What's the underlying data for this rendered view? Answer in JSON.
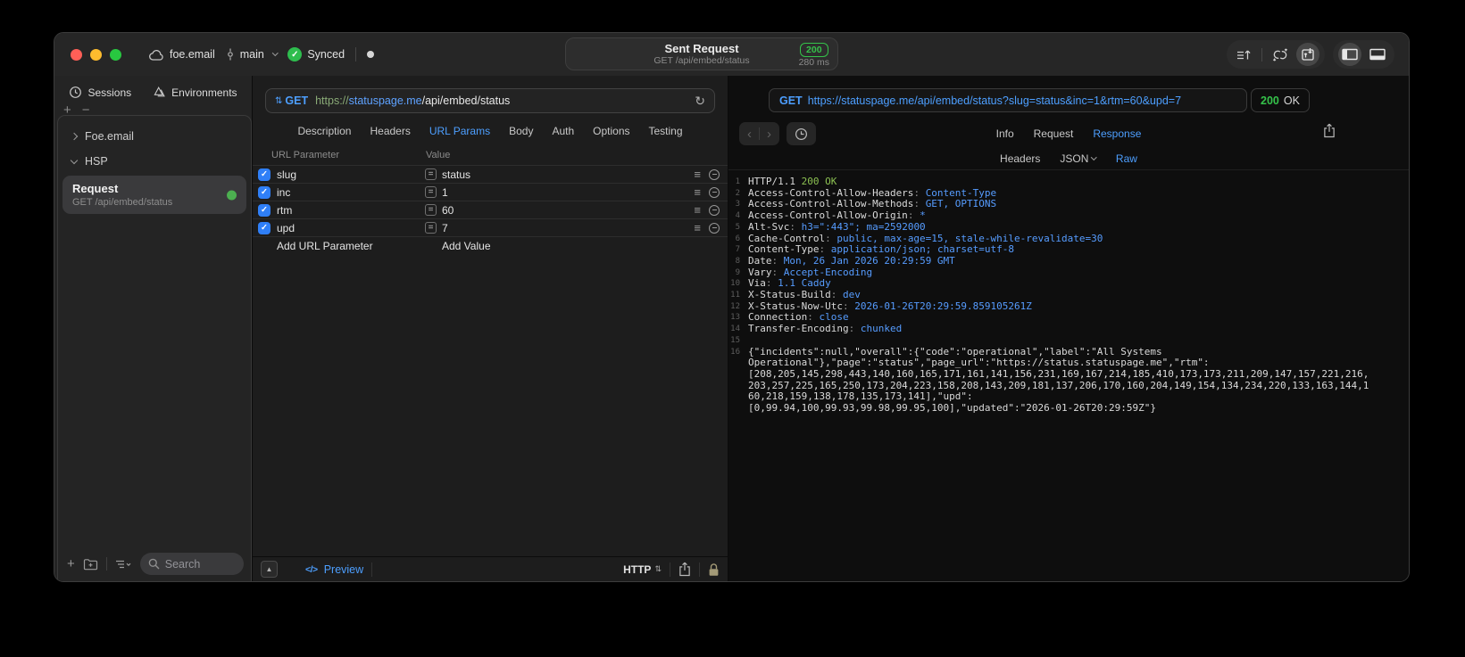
{
  "app": {
    "accent_blue": "#4D9FFF",
    "status_green": "#35C24A",
    "checkbox_blue": "#2F7FF7"
  },
  "titlebar": {
    "project": "foe.email",
    "branch": "main",
    "sync_label": "Synced",
    "request_summary": {
      "title": "Sent Request",
      "method_path": "GET /api/embed/status",
      "status_code": "200",
      "duration": "280 ms"
    }
  },
  "sidebar": {
    "tabs": [
      {
        "label": "Sessions"
      },
      {
        "label": "Environments"
      }
    ],
    "tree": [
      {
        "label": "Foe.email"
      },
      {
        "label": "HSP"
      }
    ],
    "request_item": {
      "title": "Request",
      "subtitle": "GET /api/embed/status"
    },
    "search_placeholder": "Search"
  },
  "request_panel": {
    "method": "GET",
    "url": {
      "scheme": "https://",
      "host": "statuspage.me",
      "path": "/api/embed/status"
    },
    "tabs": [
      "Description",
      "Headers",
      "URL Params",
      "Body",
      "Auth",
      "Options",
      "Testing"
    ],
    "active_tab": "URL Params",
    "params": {
      "columns": {
        "name": "URL Parameter",
        "value": "Value"
      },
      "rows": [
        {
          "name": "slug",
          "value": "status",
          "enabled": true
        },
        {
          "name": "inc",
          "value": "1",
          "enabled": true
        },
        {
          "name": "rtm",
          "value": "60",
          "enabled": true
        },
        {
          "name": "upd",
          "value": "7",
          "enabled": true
        }
      ],
      "add_name_placeholder": "Add URL Parameter",
      "add_value_placeholder": "Add Value"
    },
    "bottom_bar": {
      "preview_label": "Preview",
      "protocol": "HTTP"
    }
  },
  "response_panel": {
    "request_line": {
      "method": "GET",
      "url": "https://statuspage.me/api/embed/status?slug=status&inc=1&rtm=60&upd=7"
    },
    "status": {
      "code": "200",
      "text": "OK"
    },
    "tabs": [
      "Info",
      "Request",
      "Response"
    ],
    "active_tab": "Response",
    "subtabs": [
      "Headers",
      "JSON",
      "Raw"
    ],
    "active_subtab": "Raw",
    "body_lines": [
      {
        "n": "1",
        "segs": [
          [
            "HTTP/1.1 ",
            "w"
          ],
          [
            "200 OK",
            "g"
          ]
        ]
      },
      {
        "n": "2",
        "segs": [
          [
            "Access-Control-Allow-Headers",
            "w"
          ],
          [
            ": ",
            "d"
          ],
          [
            "Content-Type",
            "b"
          ]
        ]
      },
      {
        "n": "3",
        "segs": [
          [
            "Access-Control-Allow-Methods",
            "w"
          ],
          [
            ": ",
            "d"
          ],
          [
            "GET, OPTIONS",
            "b"
          ]
        ]
      },
      {
        "n": "4",
        "segs": [
          [
            "Access-Control-Allow-Origin",
            "w"
          ],
          [
            ": ",
            "d"
          ],
          [
            "*",
            "b"
          ]
        ]
      },
      {
        "n": "5",
        "segs": [
          [
            "Alt-Svc",
            "w"
          ],
          [
            ": ",
            "d"
          ],
          [
            "h3=\":443\"; ma=2592000",
            "b"
          ]
        ]
      },
      {
        "n": "6",
        "segs": [
          [
            "Cache-Control",
            "w"
          ],
          [
            ": ",
            "d"
          ],
          [
            "public, max-age=15, stale-while-revalidate=30",
            "b"
          ]
        ]
      },
      {
        "n": "7",
        "segs": [
          [
            "Content-Type",
            "w"
          ],
          [
            ": ",
            "d"
          ],
          [
            "application/json; charset=utf-8",
            "b"
          ]
        ]
      },
      {
        "n": "8",
        "segs": [
          [
            "Date",
            "w"
          ],
          [
            ": ",
            "d"
          ],
          [
            "Mon, 26 Jan 2026 20:29:59 GMT",
            "b"
          ]
        ]
      },
      {
        "n": "9",
        "segs": [
          [
            "Vary",
            "w"
          ],
          [
            ": ",
            "d"
          ],
          [
            "Accept-Encoding",
            "b"
          ]
        ]
      },
      {
        "n": "10",
        "segs": [
          [
            "Via",
            "w"
          ],
          [
            ": ",
            "d"
          ],
          [
            "1.1 Caddy",
            "b"
          ]
        ]
      },
      {
        "n": "11",
        "segs": [
          [
            "X-Status-Build",
            "w"
          ],
          [
            ": ",
            "d"
          ],
          [
            "dev",
            "b"
          ]
        ]
      },
      {
        "n": "12",
        "segs": [
          [
            "X-Status-Now-Utc",
            "w"
          ],
          [
            ": ",
            "d"
          ],
          [
            "2026-01-26T20:29:59.859105261Z",
            "b"
          ]
        ]
      },
      {
        "n": "13",
        "segs": [
          [
            "Connection",
            "w"
          ],
          [
            ": ",
            "d"
          ],
          [
            "close",
            "b"
          ]
        ]
      },
      {
        "n": "14",
        "segs": [
          [
            "Transfer-Encoding",
            "w"
          ],
          [
            ": ",
            "d"
          ],
          [
            "chunked",
            "b"
          ]
        ]
      },
      {
        "n": "15",
        "segs": []
      },
      {
        "n": "16",
        "segs": [
          [
            "{\"incidents\":null,\"overall\":{\"code\":\"operational\",\"label\":\"All Systems",
            "w"
          ]
        ]
      },
      {
        "n": "",
        "segs": [
          [
            "Operational\"},\"page\":\"status\",\"page_url\":\"https://status.statuspage.me\",\"rtm\":",
            "w"
          ]
        ]
      },
      {
        "n": "",
        "segs": [
          [
            "[208,205,145,298,443,140,160,165,171,161,141,156,231,169,167,214,185,410,173,173,211,209,147,157,221,216,",
            "w"
          ]
        ]
      },
      {
        "n": "",
        "segs": [
          [
            "203,257,225,165,250,173,204,223,158,208,143,209,181,137,206,170,160,204,149,154,134,234,220,133,163,144,1",
            "w"
          ]
        ]
      },
      {
        "n": "",
        "segs": [
          [
            "60,218,159,138,178,135,173,141],\"upd\":",
            "w"
          ]
        ]
      },
      {
        "n": "",
        "segs": [
          [
            "[0,99.94,100,99.93,99.98,99.95,100],\"updated\":\"2026-01-26T20:29:59Z\"}",
            "w"
          ]
        ]
      }
    ]
  },
  "icons": {
    "stepper": "⇅",
    "refresh": "↻",
    "hamburger": "≡",
    "equals": "=",
    "check": "✓",
    "collapse": "▲",
    "code": "</>",
    "back": "‹",
    "forward": "›",
    "plus": "+",
    "minus": "−"
  }
}
